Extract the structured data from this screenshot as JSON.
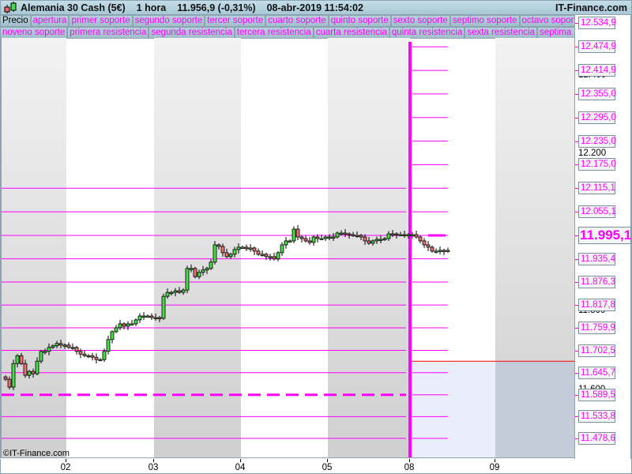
{
  "header": {
    "instrument": "Alemania 30 Cash (5€)",
    "timeframe": "1 hora",
    "price_change": "11.956,9 (-0,31%)",
    "datetime": "08-abr-2019 11:54:02",
    "brand": "IT-Finance.com"
  },
  "tabs_row1": [
    "Precio",
    "apertura",
    "primer soporte",
    "segundo soporte",
    "tercer soporte",
    "cuarto soporte",
    "quinto soporte",
    "sexto soporte",
    "septimo soporte",
    "octavo soporte"
  ],
  "tabs_row2": [
    "noveno soporte",
    "primera resistencia",
    "segunda resistencia",
    "tercera resistencia",
    "cuarta resistencia",
    "quinta resistencia",
    "sexta resistencia",
    "septima resistencia"
  ],
  "levels": [
    "12.534,9",
    "12.474,9",
    "12.414,9",
    "12.355,0",
    "12.295,0",
    "12.235,0",
    "12.175,0",
    "12.115,1",
    "12.055,1",
    "11.995,1",
    "11.935,4",
    "11.876,3",
    "11.817,8",
    "11.759,9",
    "11.702,5",
    "11.645,7",
    "11.589,5",
    "11.533,8",
    "11.478,6"
  ],
  "current_level": "11.995,1",
  "price_ticks": [
    "12.400",
    "12.200",
    "11.800",
    "11.600"
  ],
  "x_labels": [
    "02",
    "03",
    "04",
    "05",
    "08",
    "09"
  ],
  "copyright": "©IT-Finance.com",
  "colors": {
    "level": "#ff00ff",
    "up": "#44dd44",
    "down": "#e87070",
    "red_line": "#ff0000"
  },
  "chart_data": {
    "type": "candlestick",
    "ylim": [
      11425,
      12560
    ],
    "closes": [
      11629,
      11609,
      11669,
      11689,
      11669,
      11639,
      11649,
      11643,
      11675,
      11700,
      11700,
      11710,
      11714,
      11720,
      11716,
      11716,
      11710,
      11710,
      11700,
      11693,
      11689,
      11689,
      11685,
      11679,
      11679,
      11700,
      11730,
      11750,
      11760,
      11770,
      11764,
      11770,
      11770,
      11780,
      11790,
      11790,
      11790,
      11786,
      11786,
      11784,
      11840,
      11850,
      11850,
      11854,
      11850,
      11856,
      11911,
      11911,
      11890,
      11901,
      11907,
      11911,
      11927,
      11971,
      11967,
      11951,
      11941,
      11947,
      11959,
      11965,
      11965,
      11961,
      11963,
      11955,
      11947,
      11947,
      11941,
      11941,
      11935,
      11951,
      11971,
      11981,
      11981,
      12011,
      11991,
      11987,
      11981,
      11977,
      11991,
      11987,
      11987,
      11991,
      11991,
      11991,
      12001,
      12001,
      11999,
      11997,
      11995,
      11995,
      11991,
      11981,
      11975,
      11981,
      11985,
      11985,
      11987,
      11999,
      11999,
      11997,
      11997,
      11995,
      11997,
      11997,
      11991,
      11981,
      11971,
      11965,
      11955,
      11955,
      11957,
      11955,
      11957
    ]
  }
}
